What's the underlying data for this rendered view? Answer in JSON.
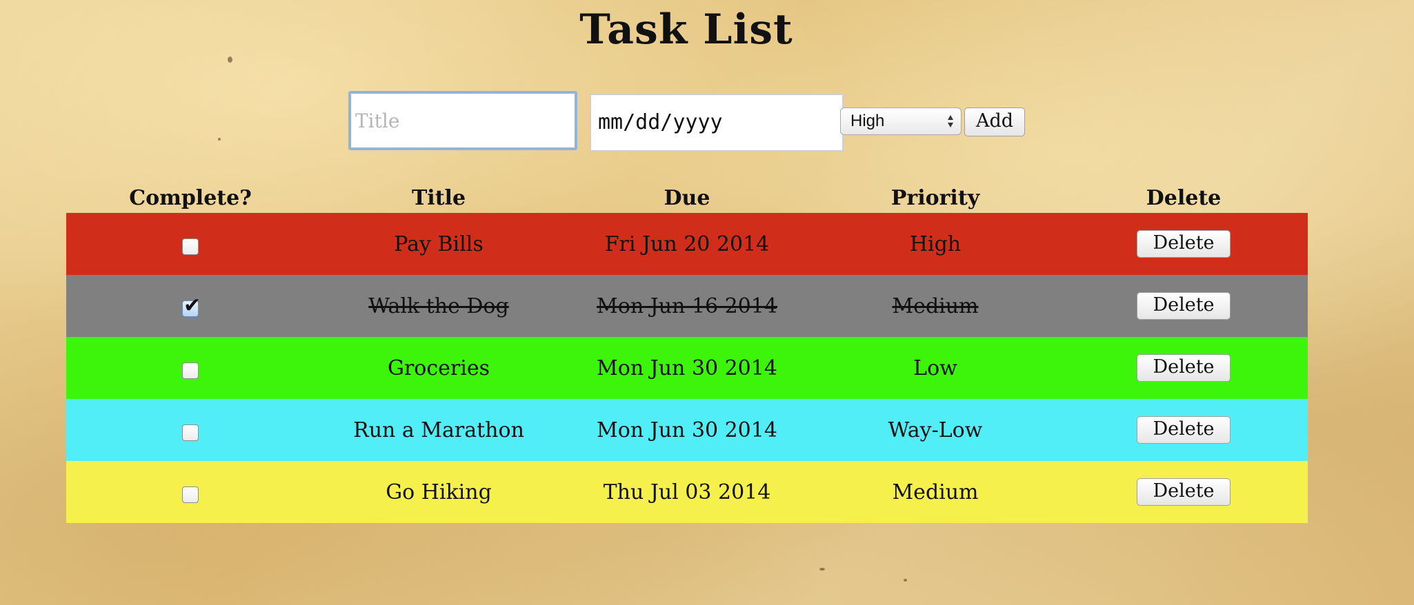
{
  "page": {
    "title": "Task List"
  },
  "form": {
    "title_placeholder": "Title",
    "date_placeholder": "mm/dd/yyyy",
    "priority_selected": "High",
    "add_label": "Add"
  },
  "table": {
    "headers": {
      "complete": "Complete?",
      "title": "Title",
      "due": "Due",
      "priority": "Priority",
      "delete": "Delete"
    },
    "rows": [
      {
        "complete": false,
        "title": "Pay Bills",
        "due": "Fri Jun 20 2014",
        "priority": "High",
        "delete_label": "Delete",
        "color": "#d02d1a"
      },
      {
        "complete": true,
        "title": "Walk the Dog",
        "due": "Mon Jun 16 2014",
        "priority": "Medium",
        "delete_label": "Delete",
        "color": "#808080"
      },
      {
        "complete": false,
        "title": "Groceries",
        "due": "Mon Jun 30 2014",
        "priority": "Low",
        "delete_label": "Delete",
        "color": "#3cf50a"
      },
      {
        "complete": false,
        "title": "Run a Marathon",
        "due": "Mon Jun 30 2014",
        "priority": "Way-Low",
        "delete_label": "Delete",
        "color": "#52eef8"
      },
      {
        "complete": false,
        "title": "Go Hiking",
        "due": "Thu Jul 03 2014",
        "priority": "Medium",
        "delete_label": "Delete",
        "color": "#f5f04c"
      }
    ]
  }
}
